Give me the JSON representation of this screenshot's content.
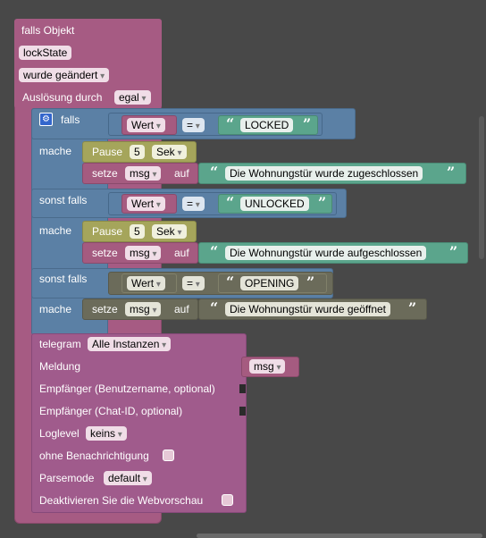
{
  "trigger": {
    "title": "falls Objekt",
    "object_id": "lockState",
    "condition": "wurde geändert",
    "trigger_label": "Auslösung durch",
    "trigger_value": "egal"
  },
  "if_block": {
    "gear_icon": "gear-icon",
    "if_label": "falls",
    "do_label": "mache",
    "elseif_label": "sonst falls"
  },
  "branches": [
    {
      "compare_left": "Wert",
      "op": "=",
      "value": "LOCKED",
      "pause_label": "Pause",
      "pause_value": "5",
      "pause_unit": "Sek",
      "set_label": "setze",
      "var": "msg",
      "to_label": "auf",
      "message": "Die Wohnungstür wurde zugeschlossen"
    },
    {
      "compare_left": "Wert",
      "op": "=",
      "value": "UNLOCKED",
      "pause_label": "Pause",
      "pause_value": "5",
      "pause_unit": "Sek",
      "set_label": "setze",
      "var": "msg",
      "to_label": "auf",
      "message": "Die Wohnungstür wurde aufgeschlossen"
    },
    {
      "compare_left": "Wert",
      "op": "=",
      "value": "OPENING",
      "set_label": "setze",
      "var": "msg",
      "to_label": "auf",
      "message": "Die Wohnungstür wurde geöffnet"
    }
  ],
  "telegram": {
    "label": "telegram",
    "instance": "Alle Instanzen",
    "message_label": "Meldung",
    "message_var": "msg",
    "recipient_user_label": "Empfänger (Benutzername, optional)",
    "recipient_chat_label": "Empfänger (Chat-ID, optional)",
    "loglevel_label": "Loglevel",
    "loglevel_value": "keins",
    "silent_label": "ohne Benachrichtigung",
    "parsemode_label": "Parsemode",
    "parsemode_value": "default",
    "disable_preview_label": "Deaktivieren Sie die Webvorschau"
  },
  "colors": {
    "background": "#484848",
    "trigger_block": "#a65b83",
    "if_block": "#5b80a5",
    "pause_block": "#a5a55b",
    "set_block": "#a55b80",
    "string_block": "#5ba58c",
    "compare_block": "#5b80a5",
    "telegram_block": "#a05b8c"
  }
}
